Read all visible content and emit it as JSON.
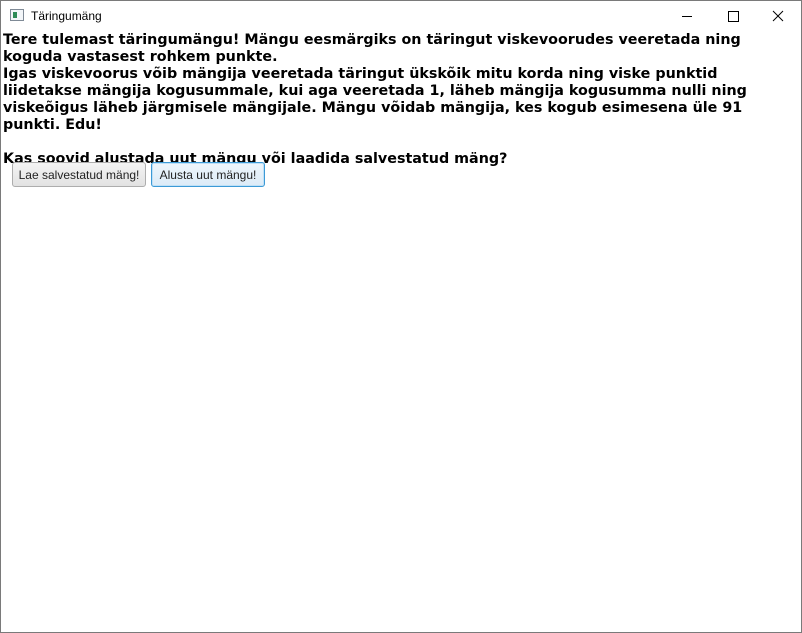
{
  "window": {
    "title": "Täringumäng"
  },
  "intro": {
    "line1": "Tere tulemast täringumängu! Mängu eesmärgiks on täringut viskevoorudes veeretada ning koguda vastasest rohkem punkte.",
    "line2": "Igas viskevoorus võib mängija veeretada täringut ükskõik mitu korda ning viske punktid liidetakse mängija kogusummale, kui aga veeretada 1, läheb mängija kogusumma nulli ning viskeõigus läheb järgmisele mängijale. Mängu võidab mängija, kes kogub esimesena üle 91 punkti. Edu!",
    "question": "Kas soovid alustada uut mängu või laadida salvestatud mäng?"
  },
  "buttons": {
    "load_label": "Lae salvestatud mäng!",
    "new_label": "Alusta uut mängu!"
  },
  "icons": {
    "app": "dice-app-icon",
    "minimize": "minimize-icon",
    "maximize": "maximize-icon",
    "close": "close-icon"
  }
}
